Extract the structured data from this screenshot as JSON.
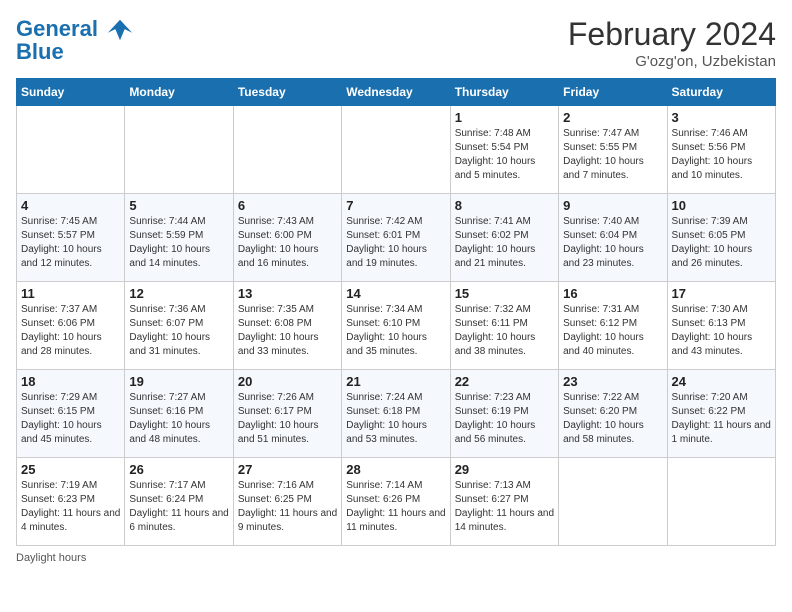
{
  "logo": {
    "line1": "General",
    "line2": "Blue"
  },
  "title": "February 2024",
  "subtitle": "G'ozg'on, Uzbekistan",
  "days_of_week": [
    "Sunday",
    "Monday",
    "Tuesday",
    "Wednesday",
    "Thursday",
    "Friday",
    "Saturday"
  ],
  "weeks": [
    [
      {
        "day": "",
        "info": ""
      },
      {
        "day": "",
        "info": ""
      },
      {
        "day": "",
        "info": ""
      },
      {
        "day": "",
        "info": ""
      },
      {
        "day": "1",
        "info": "Sunrise: 7:48 AM\nSunset: 5:54 PM\nDaylight: 10 hours and 5 minutes."
      },
      {
        "day": "2",
        "info": "Sunrise: 7:47 AM\nSunset: 5:55 PM\nDaylight: 10 hours and 7 minutes."
      },
      {
        "day": "3",
        "info": "Sunrise: 7:46 AM\nSunset: 5:56 PM\nDaylight: 10 hours and 10 minutes."
      }
    ],
    [
      {
        "day": "4",
        "info": "Sunrise: 7:45 AM\nSunset: 5:57 PM\nDaylight: 10 hours and 12 minutes."
      },
      {
        "day": "5",
        "info": "Sunrise: 7:44 AM\nSunset: 5:59 PM\nDaylight: 10 hours and 14 minutes."
      },
      {
        "day": "6",
        "info": "Sunrise: 7:43 AM\nSunset: 6:00 PM\nDaylight: 10 hours and 16 minutes."
      },
      {
        "day": "7",
        "info": "Sunrise: 7:42 AM\nSunset: 6:01 PM\nDaylight: 10 hours and 19 minutes."
      },
      {
        "day": "8",
        "info": "Sunrise: 7:41 AM\nSunset: 6:02 PM\nDaylight: 10 hours and 21 minutes."
      },
      {
        "day": "9",
        "info": "Sunrise: 7:40 AM\nSunset: 6:04 PM\nDaylight: 10 hours and 23 minutes."
      },
      {
        "day": "10",
        "info": "Sunrise: 7:39 AM\nSunset: 6:05 PM\nDaylight: 10 hours and 26 minutes."
      }
    ],
    [
      {
        "day": "11",
        "info": "Sunrise: 7:37 AM\nSunset: 6:06 PM\nDaylight: 10 hours and 28 minutes."
      },
      {
        "day": "12",
        "info": "Sunrise: 7:36 AM\nSunset: 6:07 PM\nDaylight: 10 hours and 31 minutes."
      },
      {
        "day": "13",
        "info": "Sunrise: 7:35 AM\nSunset: 6:08 PM\nDaylight: 10 hours and 33 minutes."
      },
      {
        "day": "14",
        "info": "Sunrise: 7:34 AM\nSunset: 6:10 PM\nDaylight: 10 hours and 35 minutes."
      },
      {
        "day": "15",
        "info": "Sunrise: 7:32 AM\nSunset: 6:11 PM\nDaylight: 10 hours and 38 minutes."
      },
      {
        "day": "16",
        "info": "Sunrise: 7:31 AM\nSunset: 6:12 PM\nDaylight: 10 hours and 40 minutes."
      },
      {
        "day": "17",
        "info": "Sunrise: 7:30 AM\nSunset: 6:13 PM\nDaylight: 10 hours and 43 minutes."
      }
    ],
    [
      {
        "day": "18",
        "info": "Sunrise: 7:29 AM\nSunset: 6:15 PM\nDaylight: 10 hours and 45 minutes."
      },
      {
        "day": "19",
        "info": "Sunrise: 7:27 AM\nSunset: 6:16 PM\nDaylight: 10 hours and 48 minutes."
      },
      {
        "day": "20",
        "info": "Sunrise: 7:26 AM\nSunset: 6:17 PM\nDaylight: 10 hours and 51 minutes."
      },
      {
        "day": "21",
        "info": "Sunrise: 7:24 AM\nSunset: 6:18 PM\nDaylight: 10 hours and 53 minutes."
      },
      {
        "day": "22",
        "info": "Sunrise: 7:23 AM\nSunset: 6:19 PM\nDaylight: 10 hours and 56 minutes."
      },
      {
        "day": "23",
        "info": "Sunrise: 7:22 AM\nSunset: 6:20 PM\nDaylight: 10 hours and 58 minutes."
      },
      {
        "day": "24",
        "info": "Sunrise: 7:20 AM\nSunset: 6:22 PM\nDaylight: 11 hours and 1 minute."
      }
    ],
    [
      {
        "day": "25",
        "info": "Sunrise: 7:19 AM\nSunset: 6:23 PM\nDaylight: 11 hours and 4 minutes."
      },
      {
        "day": "26",
        "info": "Sunrise: 7:17 AM\nSunset: 6:24 PM\nDaylight: 11 hours and 6 minutes."
      },
      {
        "day": "27",
        "info": "Sunrise: 7:16 AM\nSunset: 6:25 PM\nDaylight: 11 hours and 9 minutes."
      },
      {
        "day": "28",
        "info": "Sunrise: 7:14 AM\nSunset: 6:26 PM\nDaylight: 11 hours and 11 minutes."
      },
      {
        "day": "29",
        "info": "Sunrise: 7:13 AM\nSunset: 6:27 PM\nDaylight: 11 hours and 14 minutes."
      },
      {
        "day": "",
        "info": ""
      },
      {
        "day": "",
        "info": ""
      }
    ]
  ],
  "footer": "Daylight hours"
}
